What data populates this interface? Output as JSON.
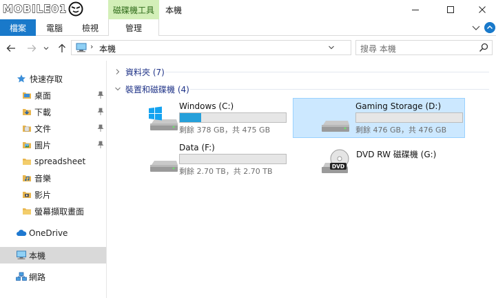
{
  "logo": {
    "text": "MOBILE01"
  },
  "window": {
    "context_tab_group": "磁碟機工具",
    "title": "本機"
  },
  "ribbon": {
    "tabs": [
      {
        "label": "檔案"
      },
      {
        "label": "電腦"
      },
      {
        "label": "檢視"
      },
      {
        "label": "管理"
      }
    ]
  },
  "address": {
    "separator": "›",
    "path": "本機"
  },
  "search": {
    "placeholder": "搜尋 本機"
  },
  "sidebar": {
    "items": [
      {
        "label": "快速存取",
        "icon": "star-icon"
      },
      {
        "label": "桌面",
        "icon": "folder-icon",
        "pinned": true
      },
      {
        "label": "下載",
        "icon": "download-folder-icon",
        "pinned": true
      },
      {
        "label": "文件",
        "icon": "documents-folder-icon",
        "pinned": true
      },
      {
        "label": "圖片",
        "icon": "pictures-folder-icon",
        "pinned": true
      },
      {
        "label": "spreadsheet",
        "icon": "folder-icon"
      },
      {
        "label": "音樂",
        "icon": "music-folder-icon"
      },
      {
        "label": "影片",
        "icon": "videos-folder-icon"
      },
      {
        "label": "螢幕擷取畫面",
        "icon": "folder-icon"
      },
      {
        "label": "OneDrive",
        "icon": "cloud-icon"
      },
      {
        "label": "本機",
        "icon": "computer-icon",
        "selected": true
      },
      {
        "label": "網路",
        "icon": "network-icon"
      }
    ]
  },
  "groups": [
    {
      "label": "資料夾 (7)",
      "collapsed": true
    },
    {
      "label": "裝置和磁碟機 (4)",
      "collapsed": false
    }
  ],
  "drives": [
    {
      "name": "Windows (C:)",
      "size_text": "剩餘 378 GB，共 475 GB",
      "used_fraction": 0.204,
      "icon": "windows-drive-icon"
    },
    {
      "name": "Gaming Storage (D:)",
      "size_text": "剩餘 476 GB，共 476 GB",
      "used_fraction": 0.0,
      "icon": "hard-drive-icon",
      "selected": true
    },
    {
      "name": "Data (F:)",
      "size_text": "剩餘 2.70 TB，共 2.70 TB",
      "used_fraction": 0.0,
      "icon": "hard-drive-icon"
    },
    {
      "name": "DVD RW 磁碟機 (G:)",
      "icon": "dvd-drive-icon"
    }
  ],
  "colors": {
    "accent": "#1979ca",
    "selection": "#cce8ff",
    "usage_bar": "#26a0da",
    "context_tab": "#d3efb8"
  }
}
